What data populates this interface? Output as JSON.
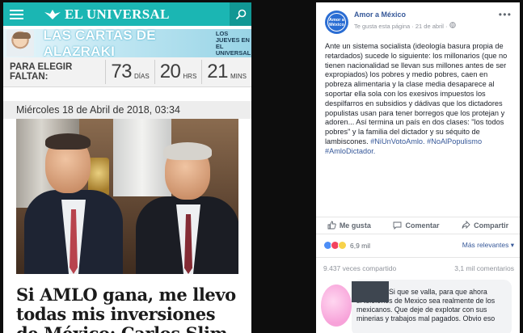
{
  "left": {
    "site_name": "EL UNIVERSAL",
    "banner": {
      "title_prefix": "LAS CARTAS DE ",
      "title_name": "ALAZRAKI",
      "subtitle": "LOS JUEVES EN EL UNIVERSAL"
    },
    "countdown": {
      "label": "PARA ELEGIR FALTAN:",
      "days": "73",
      "days_unit": "DÍAS",
      "hours": "20",
      "hours_unit": "HRS",
      "minutes": "21",
      "minutes_unit": "MINS"
    },
    "dateline": "Miércoles 18 de Abril de 2018, 03:34",
    "headline": "Si AMLO gana, me llevo todas mis inversiones de México; Carlos Slim."
  },
  "post": {
    "page_name": "Amor a México",
    "avatar_text": "Amor a México",
    "meta": "Te gusta esta página · 21 de abril ·",
    "body": "Ante un sistema socialista (ideología basura propia de retardados) sucede lo siguiente: los millonarios (que no tienen nacionalidad se llevan sus millones antes de ser expropiados) los pobres y medio pobres, caen en pobreza alimentaria y la clase media desaparece al soportar ella sola con los exesivos impuestos los despilfarros en subsidios y dádivas que los dictadores populistas usan para tener borregos que los protejan y adoren... Así termina un país en dos clases: \"los todos pobres\" y la familia del dictador y su séquito de lambiscones.",
    "hashtags": "#NiUnVotoAmlo. #NoAlPopulismo #AmloDictador.",
    "actions": {
      "like": "Me gusta",
      "comment": "Comentar",
      "share": "Compartir"
    },
    "reactions_count": "6,9 mil",
    "sort_label": "Más relevantes ▾",
    "shares": "9.437 veces compartido",
    "comments_count": "3,1 mil comentarios",
    "comment": {
      "text_first": "Si que se valla, para que ahora",
      "text_rest": "si telefonos de Mexico sea realmente de los mexicanos. Que deje de explotar con sus minerias y trabajos mal pagados. Obvio eso"
    }
  },
  "colors": {
    "eu_teal": "#1bb6b3",
    "fb_link": "#365899",
    "background": "#0d0d0d"
  }
}
